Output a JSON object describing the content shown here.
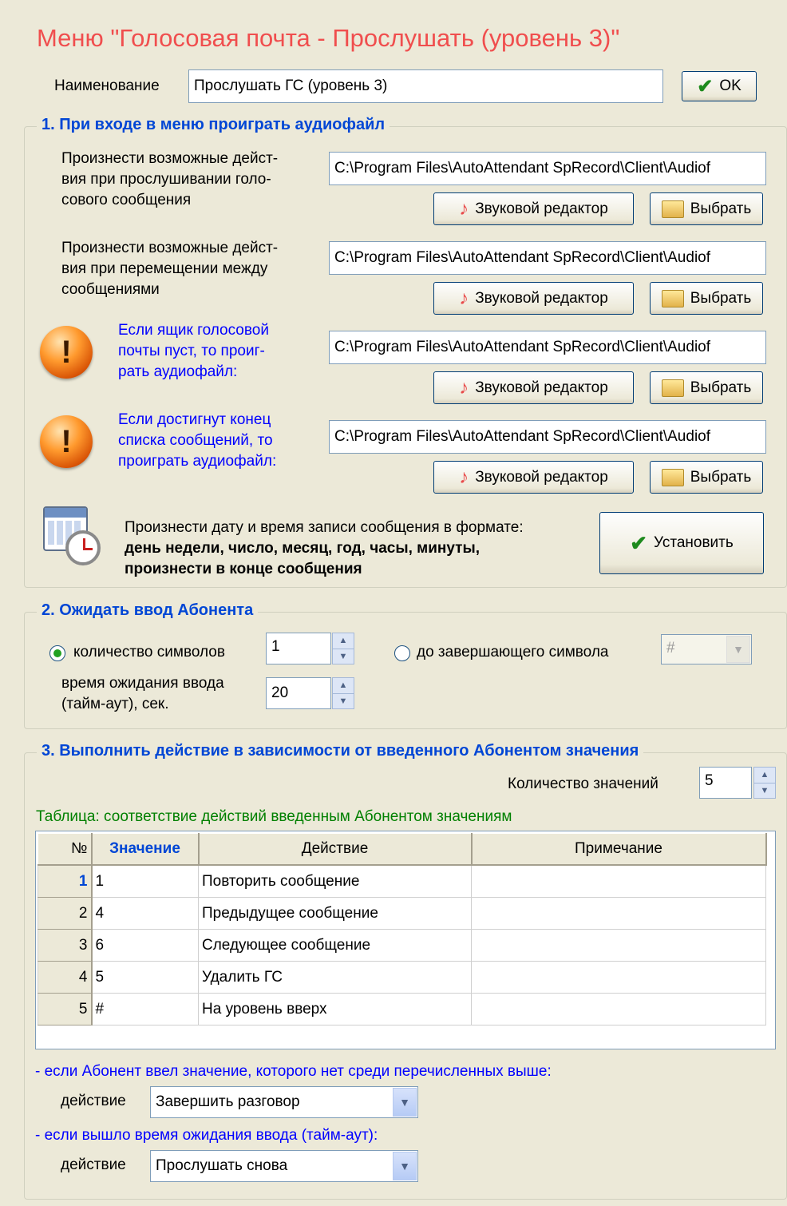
{
  "title": "Меню \"Голосовая почта - Прослушать (уровень 3)\"",
  "name_label": "Наименование",
  "name_value": "Прослушать ГС (уровень 3)",
  "ok_label": "OK",
  "section1": {
    "title": "1. При входе в меню проиграть аудиофайл",
    "rows": [
      {
        "label_lines": [
          "Произнести возможные дейст-",
          "вия при прослушивании голо-",
          "сового сообщения"
        ],
        "path": "C:\\Program Files\\AutoAttendant SpRecord\\Client\\Audiof",
        "editor_label": "Звуковой редактор",
        "choose_label": "Выбрать"
      },
      {
        "label_lines": [
          "Произнести возможные дейст-",
          "вия при перемещении между",
          "сообщениями"
        ],
        "path": "C:\\Program Files\\AutoAttendant SpRecord\\Client\\Audiof",
        "editor_label": "Звуковой редактор",
        "choose_label": "Выбрать"
      },
      {
        "label_lines": [
          "Если ящик голосовой",
          "почты пуст, то проиг-",
          "рать аудиофайл:"
        ],
        "path": "C:\\Program Files\\AutoAttendant SpRecord\\Client\\Audiof",
        "editor_label": "Звуковой редактор",
        "choose_label": "Выбрать"
      },
      {
        "label_lines": [
          "Если достигнут конец",
          "списка сообщений, то",
          "проиграть аудиофайл:"
        ],
        "path": "C:\\Program Files\\AutoAttendant SpRecord\\Client\\Audiof",
        "editor_label": "Звуковой редактор",
        "choose_label": "Выбрать"
      }
    ],
    "datetime_text": "Произнести дату и время записи сообщения в формате:",
    "datetime_bold1": "день недели, число, месяц, год, часы, минуты,",
    "datetime_bold2": "произнести в конце сообщения",
    "set_label": "Установить"
  },
  "section2": {
    "title": "2. Ожидать ввод Абонента",
    "radio_count_label": "количество символов",
    "count_value": "1",
    "radio_end_label": "до завершающего символа",
    "end_symbol": "#",
    "timeout_label_1": "время ожидания ввода",
    "timeout_label_2": "(тайм-аут), сек.",
    "timeout_value": "20"
  },
  "section3": {
    "title": "3. Выполнить действие в зависимости от введенного Абонентом значения",
    "values_count_label": "Количество значений",
    "values_count": "5",
    "table_caption": "Таблица: соответствие действий введенным Абонентом значениям",
    "columns": [
      "№",
      "Значение",
      "Действие",
      "Примечание"
    ],
    "rows": [
      {
        "n": "1",
        "value": "1",
        "action": "Повторить сообщение",
        "note": ""
      },
      {
        "n": "2",
        "value": "4",
        "action": "Предыдущее сообщение",
        "note": ""
      },
      {
        "n": "3",
        "value": "6",
        "action": "Следующее сообщение",
        "note": ""
      },
      {
        "n": "4",
        "value": "5",
        "action": "Удалить ГС",
        "note": ""
      },
      {
        "n": "5",
        "value": "#",
        "action": "На уровень вверх",
        "note": ""
      }
    ],
    "no_match_text": "- если Абонент ввел значение, которого нет среди перечисленных выше:",
    "action_label": "действие",
    "no_match_action": "Завершить разговор",
    "timeout_text": "- если вышло время ожидания ввода (тайм-аут):",
    "timeout_action": "Прослушать снова"
  },
  "colors": {
    "title": "#f04e4e",
    "group_title": "#0046d5",
    "blue_text": "#0000ff",
    "green_text": "#008000",
    "window_bg": "#ece9d8"
  }
}
